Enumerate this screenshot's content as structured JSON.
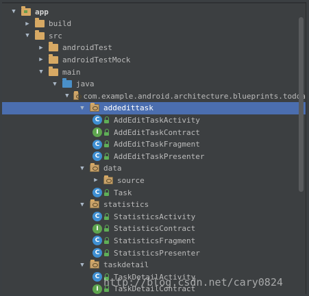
{
  "tree": {
    "rows": [
      {
        "label": "app",
        "depth": 0,
        "arrow": "expanded",
        "icon": "module-folder-icon",
        "bold": true
      },
      {
        "label": "build",
        "depth": 1,
        "arrow": "collapsed",
        "icon": "folder-icon"
      },
      {
        "label": "src",
        "depth": 1,
        "arrow": "expanded",
        "icon": "folder-icon"
      },
      {
        "label": "androidTest",
        "depth": 2,
        "arrow": "collapsed",
        "icon": "folder-icon"
      },
      {
        "label": "androidTestMock",
        "depth": 2,
        "arrow": "collapsed",
        "icon": "folder-icon"
      },
      {
        "label": "main",
        "depth": 2,
        "arrow": "expanded",
        "icon": "folder-icon"
      },
      {
        "label": "java",
        "depth": 3,
        "arrow": "expanded",
        "icon": "source-folder-icon"
      },
      {
        "label": "com.example.android.architecture.blueprints.todoa",
        "depth": 4,
        "arrow": "expanded",
        "icon": "package-icon"
      },
      {
        "label": "addedittask",
        "depth": 5,
        "arrow": "expanded",
        "icon": "package-icon",
        "selected": true
      },
      {
        "label": "AddEditTaskActivity",
        "depth": 6,
        "arrow": "none",
        "icon": "class-icon"
      },
      {
        "label": "AddEditTaskContract",
        "depth": 6,
        "arrow": "none",
        "icon": "interface-icon"
      },
      {
        "label": "AddEditTaskFragment",
        "depth": 6,
        "arrow": "none",
        "icon": "class-icon"
      },
      {
        "label": "AddEditTaskPresenter",
        "depth": 6,
        "arrow": "none",
        "icon": "class-icon"
      },
      {
        "label": "data",
        "depth": 5,
        "arrow": "expanded",
        "icon": "package-icon"
      },
      {
        "label": "source",
        "depth": 6,
        "arrow": "collapsed",
        "icon": "package-icon"
      },
      {
        "label": "Task",
        "depth": 6,
        "arrow": "none",
        "icon": "class-icon"
      },
      {
        "label": "statistics",
        "depth": 5,
        "arrow": "expanded",
        "icon": "package-icon"
      },
      {
        "label": "StatisticsActivity",
        "depth": 6,
        "arrow": "none",
        "icon": "class-icon"
      },
      {
        "label": "StatisticsContract",
        "depth": 6,
        "arrow": "none",
        "icon": "interface-icon"
      },
      {
        "label": "StatisticsFragment",
        "depth": 6,
        "arrow": "none",
        "icon": "class-icon"
      },
      {
        "label": "StatisticsPresenter",
        "depth": 6,
        "arrow": "none",
        "icon": "class-icon"
      },
      {
        "label": "taskdetail",
        "depth": 5,
        "arrow": "expanded",
        "icon": "package-icon"
      },
      {
        "label": "TaskDetailActivity",
        "depth": 6,
        "arrow": "none",
        "icon": "class-icon"
      },
      {
        "label": "TaskDetailContract",
        "depth": 6,
        "arrow": "none",
        "icon": "interface-icon"
      }
    ]
  },
  "watermark": "http://blog.csdn.net/cary0824",
  "colors": {
    "background": "#3c3f41",
    "selection": "#4b6eaf",
    "folder": "#d7a964",
    "class_icon": "#3f8fd2",
    "interface_icon": "#5ea54f"
  }
}
